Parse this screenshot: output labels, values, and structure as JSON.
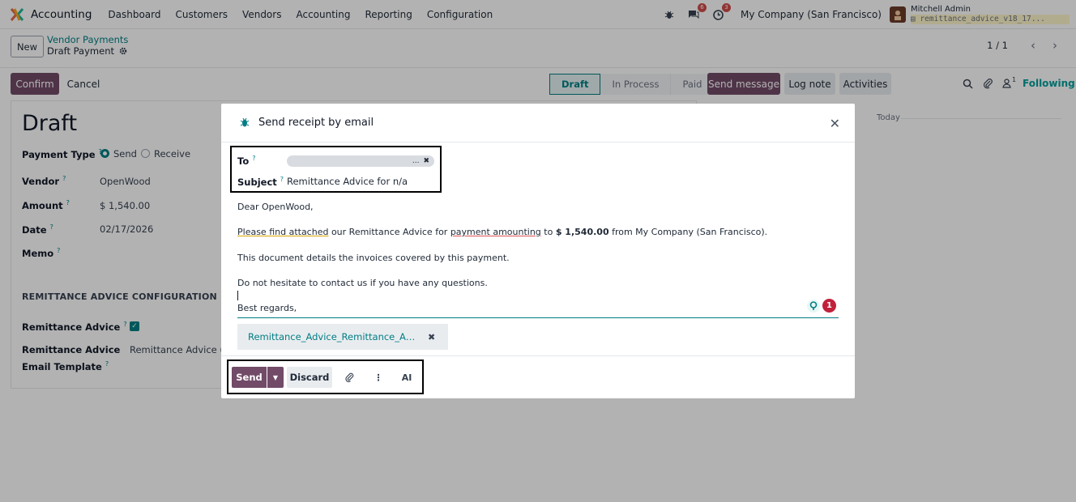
{
  "colors": {
    "brand": "#714b67",
    "accent": "#017e84",
    "badge": "#d14b4b"
  },
  "navbar": {
    "app_name": "Accounting",
    "menu": [
      "Dashboard",
      "Customers",
      "Vendors",
      "Accounting",
      "Reporting",
      "Configuration"
    ],
    "chat_badge": "6",
    "activity_badge": "3",
    "company": "My Company (San Francisco)",
    "user_name": "Mitchell Admin",
    "db_name": "remittance_advice_v18_17..."
  },
  "control_panel": {
    "new_label": "New",
    "breadcrumb_parent": "Vendor Payments",
    "breadcrumb_current": "Draft Payment",
    "pager": "1 / 1"
  },
  "actions": {
    "confirm_label": "Confirm",
    "cancel_label": "Cancel"
  },
  "status_bar": {
    "stages": [
      "Draft",
      "In Process",
      "Paid"
    ],
    "active": "Draft"
  },
  "chatter": {
    "send_message_label": "Send message",
    "log_note_label": "Log note",
    "activities_label": "Activities",
    "followers_count": "1",
    "following_label": "Following",
    "today_label": "Today"
  },
  "form": {
    "title": "Draft",
    "payment_type_label": "Payment Type",
    "payment_type_options": [
      "Send",
      "Receive"
    ],
    "payment_type_selected": "Send",
    "vendor_label": "Vendor",
    "vendor_value": "OpenWood",
    "amount_label": "Amount",
    "amount_value": "$ 1,540.00",
    "date_label": "Date",
    "date_value": "02/17/2026",
    "memo_label": "Memo",
    "section_title": "REMITTANCE ADVICE CONFIGURATION",
    "remittance_advice_label": "Remittance Advice",
    "remittance_advice_checked": true,
    "template_label_line1": "Remittance Advice",
    "template_label_line2": "Email Template",
    "template_value": "Remittance Advice (Ve"
  },
  "dialog": {
    "title": "Send receipt by email",
    "to_label": "To",
    "to_tag_overflow": "...",
    "subject_label": "Subject",
    "subject_value": "Remittance Advice for n/a",
    "body": {
      "greeting": "Dear OpenWood,",
      "line1_a": "Please find attached",
      "line1_b": " our Remittance Advice for ",
      "line1_c": "payment amounting",
      "line1_d": " to ",
      "line1_amount": "$ 1,540.00",
      "line1_e": " from My Company (San Francisco).",
      "line2": "This document details the invoices covered by this payment.",
      "line3": "Do not hesitate to contact us if you have any questions.",
      "closing": "Best regards,"
    },
    "assistant_badge": "1",
    "attachment_name": "Remittance_Advice_Remittance_Advice.pdf",
    "send_label": "Send",
    "discard_label": "Discard",
    "ai_label": "AI"
  }
}
